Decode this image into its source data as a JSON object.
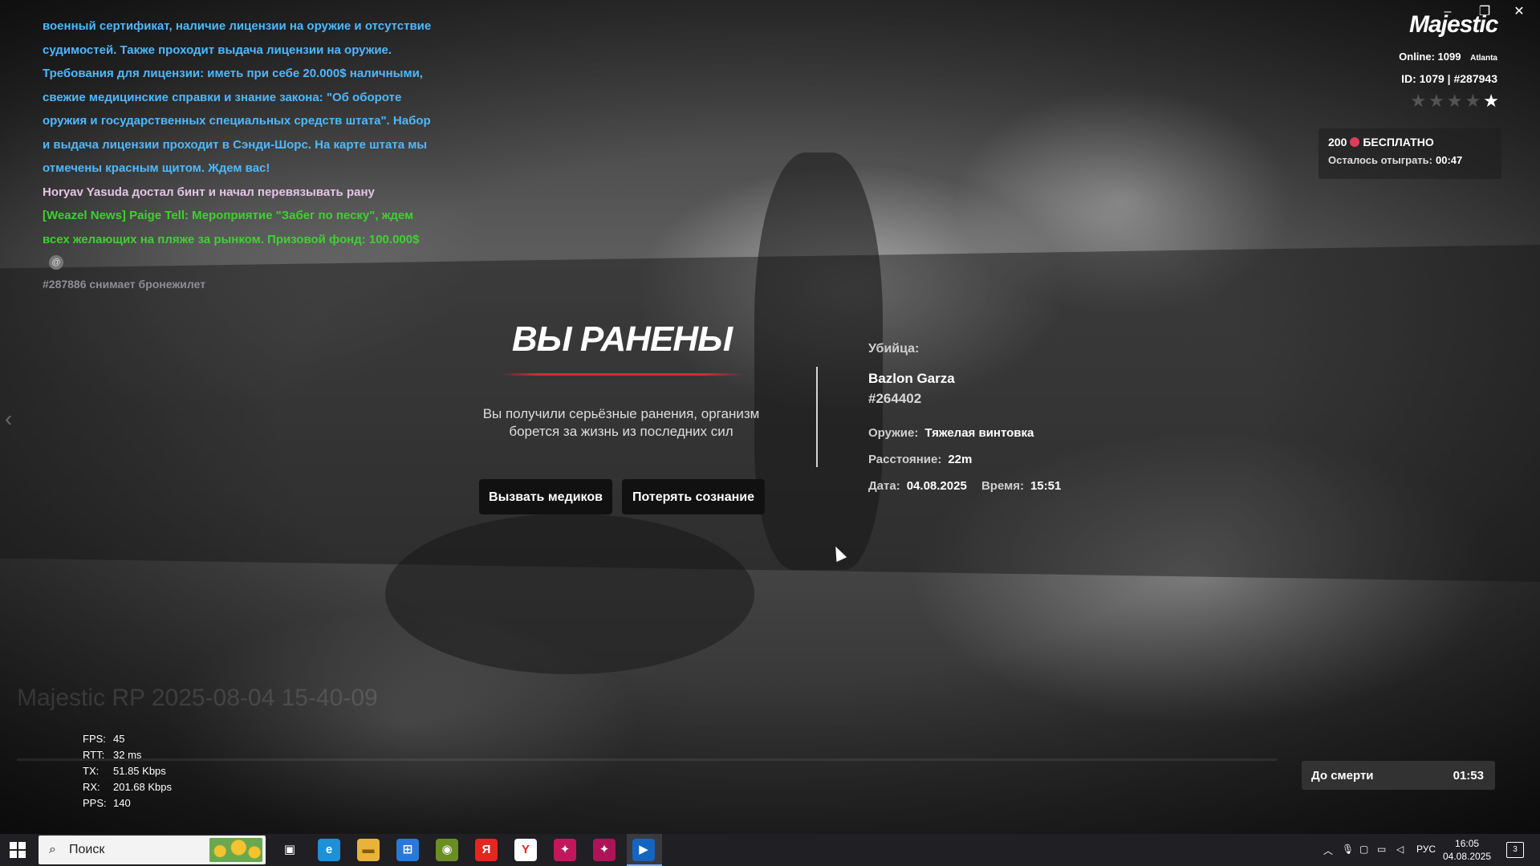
{
  "window_controls": {
    "minimize": "–",
    "restore": "❐",
    "close": "✕"
  },
  "chat": {
    "lines": [
      {
        "text": "военный сертификат, наличие лицензии на оружие и отсутствие",
        "color": "blue"
      },
      {
        "text": "судимостей. Также проходит выдача лицензии на оружие.",
        "color": "blue"
      },
      {
        "text": "Требования для лицензии: иметь при себе 20.000$ наличными,",
        "color": "blue"
      },
      {
        "text": "свежие медицинские справки и знание закона: \"Об обороте",
        "color": "blue"
      },
      {
        "text": "оружия и государственных специальных средств штата\". Набор",
        "color": "blue"
      },
      {
        "text": "и выдача лицензии проходит в Сэнди-Шорс. На карте штата мы",
        "color": "blue"
      },
      {
        "text": "отмечены красным щитом. Ждем вас!",
        "color": "blue"
      },
      {
        "text": "Horyav Yasuda достал бинт и начал перевязывать рану",
        "color": "pink"
      },
      {
        "text": "[Weazel News] Paige Tell: Мероприятие \"Забег по песку\", ждем",
        "color": "green"
      },
      {
        "text": "всех желающих на пляже за рынком. Призовой фонд: 100.000$",
        "color": "green"
      }
    ],
    "icon_glyph": "@",
    "gray_line": "#287886 снимает бронежилет"
  },
  "hud": {
    "logo": "Majestic",
    "online_label": "Online:",
    "online_value": "1099",
    "server": "Atlanta",
    "id_line": "ID: 1079 | #287943",
    "wanted_stars": 5,
    "wanted_level": 1,
    "promo_amount": "200",
    "promo_label": "БЕСПЛАТНО",
    "promo_remaining_label": "Осталось отыграть:",
    "promo_remaining_value": "00:47"
  },
  "injury": {
    "title": "ВЫ РАНЕНЫ",
    "description": "Вы получили серьёзные ранения, организм борется за жизнь из последних сил",
    "call_medics": "Вызвать медиков",
    "lose_consciousness": "Потерять сознание"
  },
  "killer": {
    "label": "Убийца:",
    "name": "Bazlon Garza",
    "id": "#264402",
    "weapon_label": "Оружие:",
    "weapon_value": "Тяжелая винтовка",
    "distance_label": "Расстояние:",
    "distance_value": "22m",
    "date_label": "Дата:",
    "date_value": "04.08.2025",
    "time_label": "Время:",
    "time_value": "15:51"
  },
  "recording": {
    "name": "Majestic RP 2025-08-04 15-40-09"
  },
  "stats": [
    {
      "key": "FPS:",
      "value": "45"
    },
    {
      "key": "RTT:",
      "value": "32 ms"
    },
    {
      "key": "TX:",
      "value": "51.85 Kbps"
    },
    {
      "key": "RX:",
      "value": "201.68 Kbps"
    },
    {
      "key": "PPS:",
      "value": "140"
    }
  ],
  "death_timer": {
    "label": "До смерти",
    "value": "01:53"
  },
  "taskbar": {
    "search_placeholder": "Поиск",
    "apps": [
      {
        "name": "task-view",
        "glyph": "▣",
        "bg": "transparent",
        "fg": "#ffffff"
      },
      {
        "name": "edge",
        "glyph": "e",
        "bg": "#1e90d6",
        "fg": "#ffffff"
      },
      {
        "name": "file-explorer",
        "glyph": "▬",
        "bg": "#e8b33b",
        "fg": "#8a5a00"
      },
      {
        "name": "store",
        "glyph": "⊞",
        "bg": "#2b79d4",
        "fg": "#ffffff"
      },
      {
        "name": "app-green",
        "glyph": "◉",
        "bg": "#6b8e23",
        "fg": "#ffffff"
      },
      {
        "name": "yandex",
        "glyph": "Я",
        "bg": "#e52620",
        "fg": "#ffffff"
      },
      {
        "name": "yandex-browser",
        "glyph": "Y",
        "bg": "#ffffff",
        "fg": "#e52620"
      },
      {
        "name": "game-app-1",
        "glyph": "✦",
        "bg": "#c2185b",
        "fg": "#ffffff"
      },
      {
        "name": "game-app-2",
        "glyph": "✦",
        "bg": "#ad1457",
        "fg": "#ffffff"
      },
      {
        "name": "launcher",
        "glyph": "▶",
        "bg": "#1565c0",
        "fg": "#ffffff"
      }
    ],
    "tray": {
      "chevron": "︿",
      "lang": "РУС"
    },
    "clock_time": "16:05",
    "clock_date": "04.08.2025",
    "notifications": "3"
  }
}
